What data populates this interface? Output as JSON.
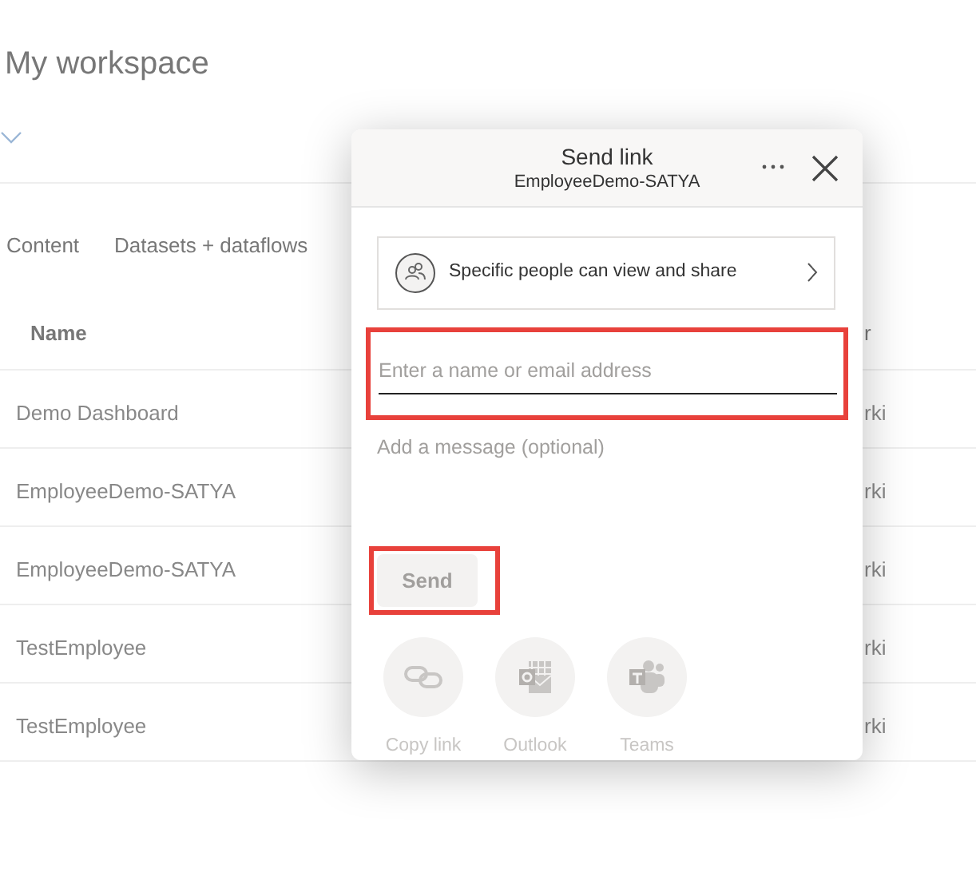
{
  "page": {
    "title": "My workspace",
    "tabs": [
      {
        "label": "Content",
        "selected": false
      },
      {
        "label": "Datasets + dataflows",
        "selected": false
      }
    ],
    "table": {
      "columns": [
        "Name",
        "r"
      ],
      "rows": [
        [
          "Demo Dashboard",
          "rki"
        ],
        [
          "EmployeeDemo-SATYA",
          "rki"
        ],
        [
          "EmployeeDemo-SATYA",
          "rki"
        ],
        [
          "TestEmployee",
          "rki"
        ],
        [
          "TestEmployee",
          "rki"
        ]
      ]
    }
  },
  "dialog": {
    "title": "Send link",
    "subtitle": "EmployeeDemo-SATYA",
    "permission": "Specific people can view and share",
    "recipient_field": {
      "placeholder": "Enter a name or email address",
      "highlighted": true
    },
    "message_field": {
      "placeholder": "Add a message (optional)"
    },
    "send_button": {
      "label": "Send",
      "disabled": true,
      "highlighted": true
    },
    "share_options": [
      {
        "kind": "link",
        "label": "Copy link"
      },
      {
        "kind": "outlook",
        "label": "Outlook"
      },
      {
        "kind": "teams",
        "label": "Teams"
      }
    ]
  }
}
